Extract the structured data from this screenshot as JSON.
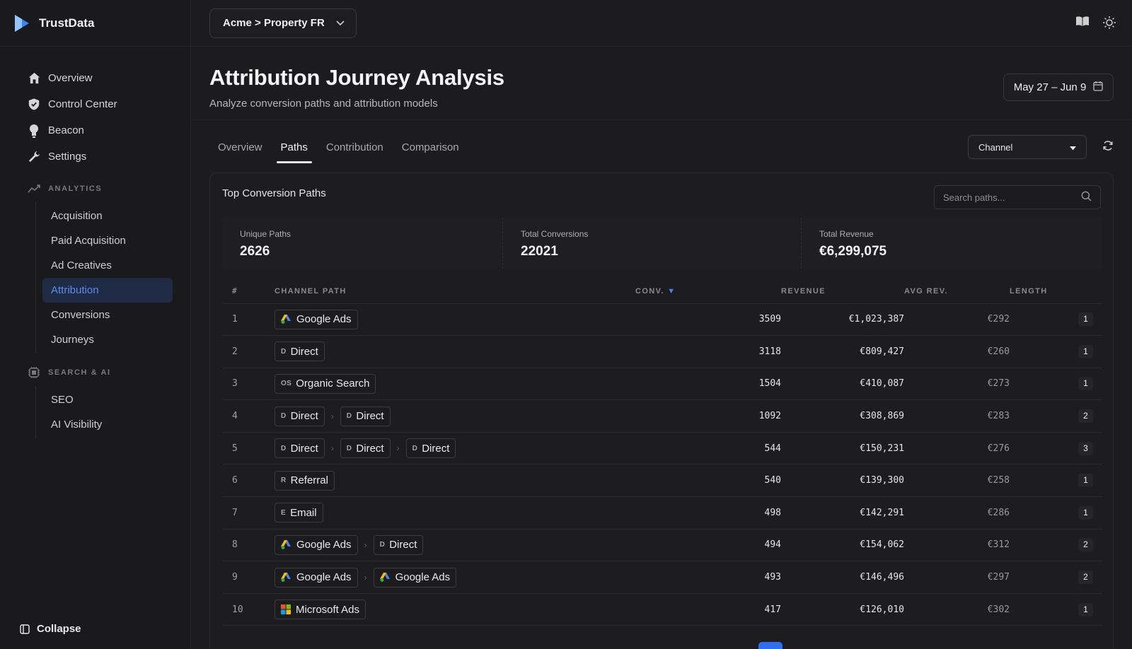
{
  "app": {
    "name": "TrustData"
  },
  "sidebar": {
    "items": [
      {
        "label": "Overview",
        "icon": "home-icon"
      },
      {
        "label": "Control Center",
        "icon": "shield-icon"
      },
      {
        "label": "Beacon",
        "icon": "bulb-icon"
      },
      {
        "label": "Settings",
        "icon": "wrench-icon"
      }
    ],
    "analytics": {
      "heading": "ANALYTICS",
      "items": [
        "Acquisition",
        "Paid Acquisition",
        "Ad Creatives",
        "Attribution",
        "Conversions",
        "Journeys"
      ],
      "active": "Attribution"
    },
    "search_ai": {
      "heading": "SEARCH & AI",
      "items": [
        "SEO",
        "AI Visibility"
      ]
    },
    "collapse_label": "Collapse"
  },
  "topbar": {
    "property": "Acme > Property FR"
  },
  "header": {
    "title": "Attribution Journey Analysis",
    "subtitle": "Analyze conversion paths and attribution models",
    "date_range": "May 27 – Jun 9"
  },
  "tabs": {
    "items": [
      "Overview",
      "Paths",
      "Contribution",
      "Comparison"
    ],
    "active": "Paths"
  },
  "grouping": {
    "value": "Channel"
  },
  "card": {
    "title": "Top Conversion Paths",
    "search_placeholder": "Search paths...",
    "stats": [
      {
        "label": "Unique Paths",
        "value": "2626"
      },
      {
        "label": "Total Conversions",
        "value": "22021"
      },
      {
        "label": "Total Revenue",
        "value": "€6,299,075"
      }
    ],
    "columns": [
      "#",
      "CHANNEL PATH",
      "CONV.",
      "REVENUE",
      "AVG REV.",
      "LENGTH"
    ],
    "sort_indicator": "▼",
    "rows": [
      {
        "idx": "1",
        "path": [
          {
            "name": "Google Ads",
            "kind": "google"
          }
        ],
        "conv": "3509",
        "revenue": "€1,023,387",
        "avg": "€292",
        "length": "1"
      },
      {
        "idx": "2",
        "path": [
          {
            "name": "Direct",
            "abbr": "D"
          }
        ],
        "conv": "3118",
        "revenue": "€809,427",
        "avg": "€260",
        "length": "1"
      },
      {
        "idx": "3",
        "path": [
          {
            "name": "Organic Search",
            "abbr": "OS"
          }
        ],
        "conv": "1504",
        "revenue": "€410,087",
        "avg": "€273",
        "length": "1"
      },
      {
        "idx": "4",
        "path": [
          {
            "name": "Direct",
            "abbr": "D"
          },
          {
            "name": "Direct",
            "abbr": "D"
          }
        ],
        "conv": "1092",
        "revenue": "€308,869",
        "avg": "€283",
        "length": "2"
      },
      {
        "idx": "5",
        "path": [
          {
            "name": "Direct",
            "abbr": "D"
          },
          {
            "name": "Direct",
            "abbr": "D"
          },
          {
            "name": "Direct",
            "abbr": "D"
          }
        ],
        "conv": "544",
        "revenue": "€150,231",
        "avg": "€276",
        "length": "3"
      },
      {
        "idx": "6",
        "path": [
          {
            "name": "Referral",
            "abbr": "R"
          }
        ],
        "conv": "540",
        "revenue": "€139,300",
        "avg": "€258",
        "length": "1"
      },
      {
        "idx": "7",
        "path": [
          {
            "name": "Email",
            "abbr": "E"
          }
        ],
        "conv": "498",
        "revenue": "€142,291",
        "avg": "€286",
        "length": "1"
      },
      {
        "idx": "8",
        "path": [
          {
            "name": "Google Ads",
            "kind": "google"
          },
          {
            "name": "Direct",
            "abbr": "D"
          }
        ],
        "conv": "494",
        "revenue": "€154,062",
        "avg": "€312",
        "length": "2"
      },
      {
        "idx": "9",
        "path": [
          {
            "name": "Google Ads",
            "kind": "google"
          },
          {
            "name": "Google Ads",
            "kind": "google"
          }
        ],
        "conv": "493",
        "revenue": "€146,496",
        "avg": "€297",
        "length": "2"
      },
      {
        "idx": "10",
        "path": [
          {
            "name": "Microsoft Ads",
            "kind": "microsoft"
          }
        ],
        "conv": "417",
        "revenue": "€126,010",
        "avg": "€302",
        "length": "1"
      }
    ]
  },
  "colors": {
    "accent": "#2f6ef0",
    "active_nav_bg": "#1f2a44",
    "active_nav_text": "#5b8ef0",
    "background": "#1c1c1e"
  }
}
